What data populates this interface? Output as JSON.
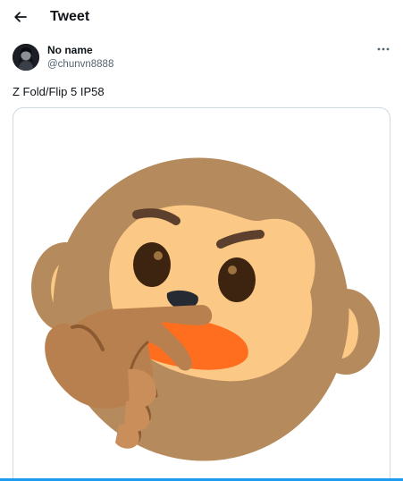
{
  "header": {
    "back_icon": "arrow-left-icon",
    "title": "Tweet"
  },
  "tweet": {
    "author": {
      "display_name": "No name",
      "handle": "@chunvn8888",
      "avatar_icon": "user-avatar"
    },
    "more_icon": "more-horizontal-icon",
    "text": "Z Fold/Flip 5 IP58",
    "media": {
      "image": "thinking-monkey-emoji"
    }
  },
  "colors": {
    "text_primary": "#0f1419",
    "text_secondary": "#536471",
    "border": "#cfd9de",
    "accent": "#1d9bf0"
  }
}
